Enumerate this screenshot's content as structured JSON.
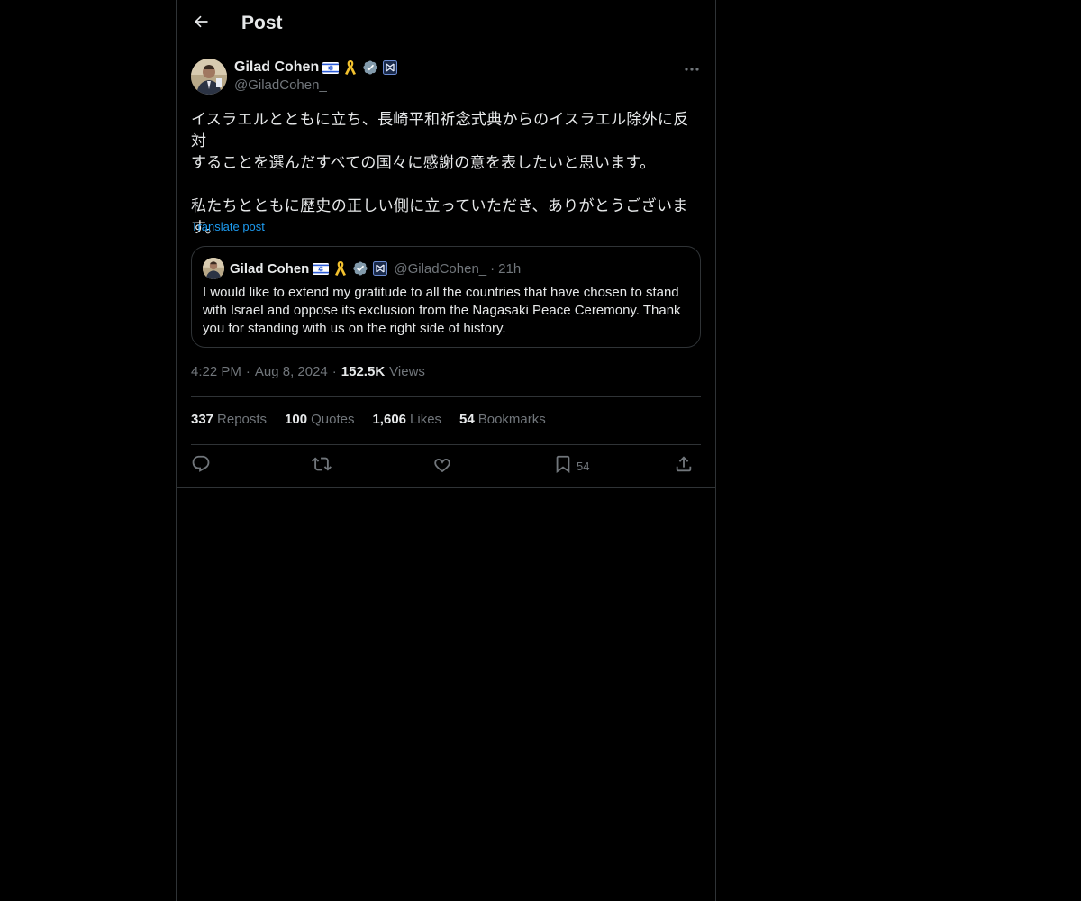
{
  "header": {
    "title": "Post"
  },
  "post": {
    "author": {
      "display_name": "Gilad Cohen",
      "handle": "@GiladCohen_"
    },
    "text": "イスラエルとともに立ち、長崎平和祈念式典からのイスラエル除外に反対\nすることを選んだすべての国々に感謝の意を表したいと思います。\n\n私たちとともに歴史の正しい側に立っていただき、ありがとうございま\nす。",
    "translate_label": "Translate post",
    "quote": {
      "display_name": "Gilad Cohen",
      "handle": "@GiladCohen_",
      "separator": "·",
      "time": "21h",
      "text": "I would like to extend my gratitude to all the countries that have chosen to stand with Israel and oppose its exclusion from the Nagasaki Peace Ceremony. Thank you for standing with us on the right side of history."
    },
    "meta": {
      "time": "4:22 PM",
      "separator": "·",
      "date": "Aug 8, 2024",
      "views_count": "152.5K",
      "views_label": "Views"
    },
    "stats": {
      "reposts": {
        "count": "337",
        "label": "Reposts"
      },
      "quotes": {
        "count": "100",
        "label": "Quotes"
      },
      "likes": {
        "count": "1,606",
        "label": "Likes"
      },
      "bookmarks": {
        "count": "54",
        "label": "Bookmarks"
      }
    },
    "actions": {
      "reply_icon": "reply-icon",
      "repost_icon": "repost-icon",
      "like_icon": "heart-icon",
      "bookmark_icon": "bookmark-icon",
      "bookmark_count": "54",
      "share_icon": "share-icon"
    }
  },
  "colors": {
    "background": "#000000",
    "text_primary": "#e7e9ea",
    "text_secondary": "#71767b",
    "link": "#1d9bf0",
    "border": "#2f3336",
    "verified": "#829aab"
  }
}
